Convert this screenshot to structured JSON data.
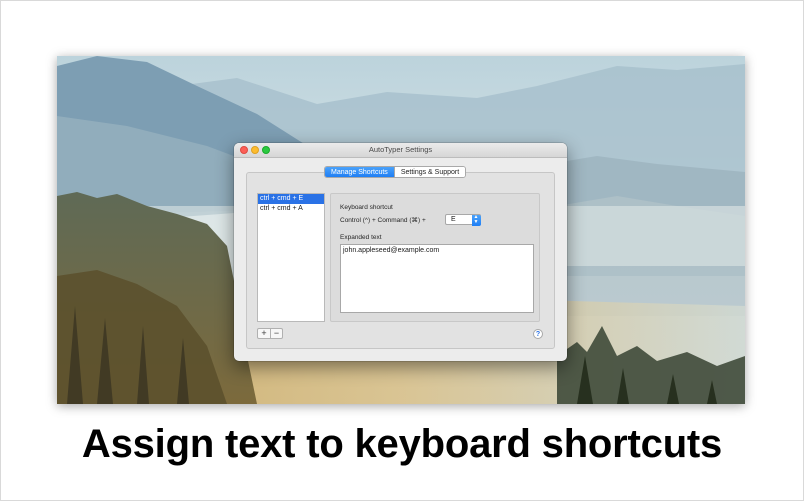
{
  "window": {
    "title": "AutoTyper Settings",
    "tabs": [
      {
        "label": "Manage Shortcuts",
        "selected": true
      },
      {
        "label": "Settings & Support",
        "selected": false
      }
    ]
  },
  "shortcuts": {
    "items": [
      {
        "label": "ctrl + cmd + E",
        "selected": true
      },
      {
        "label": "ctrl + cmd + A",
        "selected": false
      }
    ],
    "add_label": "+",
    "remove_label": "−"
  },
  "editor": {
    "shortcut_heading": "Keyboard shortcut",
    "modifier_text": "Control (^) + Command (⌘) +",
    "key_value": "E",
    "expanded_heading": "Expanded text",
    "expanded_value": "john.appleseed@example.com"
  },
  "help_label": "?",
  "caption": "Assign text to keyboard shortcuts",
  "colors": {
    "accent": "#2a72e6",
    "tab_active": "#1f7ef4",
    "close": "#fc5f57",
    "minimize": "#fdbc2e",
    "maximize": "#2ac940"
  },
  "icons": {
    "close": "close-window-icon",
    "minimize": "minimize-window-icon",
    "maximize": "maximize-window-icon",
    "popup": "popup-arrows-icon",
    "help": "help-icon"
  }
}
